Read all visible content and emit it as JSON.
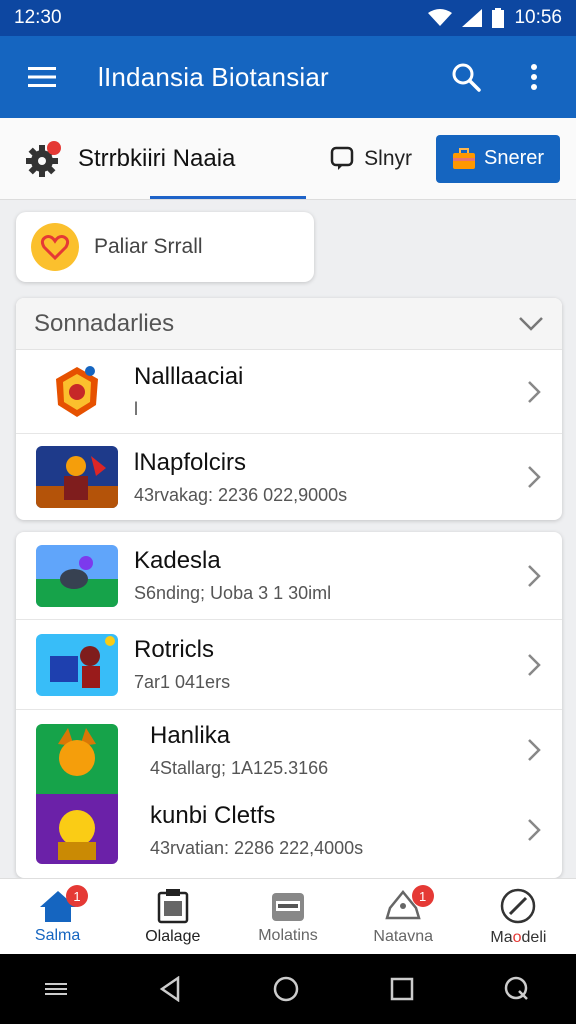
{
  "status_bar": {
    "time_left": "12:30",
    "time_right": "10:56"
  },
  "app_bar": {
    "title": "lIndansia Biotansiar"
  },
  "filter_row": {
    "title": "Strrbkiiri Naaia",
    "share_label": "Slnyr",
    "primary_label": "Snerer"
  },
  "chip": {
    "label": "Paliar Srrall"
  },
  "section1": {
    "header": "Sonnadarlies",
    "items": [
      {
        "title": "Nalllaaciai",
        "subtitle": "l"
      },
      {
        "title": "lNapfolcirs",
        "subtitle": "43rvakag: 2236 022,9000s"
      }
    ]
  },
  "section2": {
    "items": [
      {
        "title": "Kadesla",
        "subtitle": "S6nding; Uoba 3 1 30iml"
      },
      {
        "title": "Rotricls",
        "subtitle": "7ar1 041ers"
      },
      {
        "title": "Hanlika",
        "subtitle": "4Stallarg; 1A125.3166"
      },
      {
        "title": "kunbi Cletfs",
        "subtitle": "43rvatian: 2286 222,4000s"
      }
    ]
  },
  "bottom_nav": [
    {
      "label": "Salma",
      "badge": "1",
      "icon": "home-icon",
      "color": "#1565c0"
    },
    {
      "label": "Olalage",
      "badge": "",
      "icon": "clipboard-icon",
      "color": "#222222"
    },
    {
      "label": "Molatins",
      "badge": "",
      "icon": "archive-icon",
      "color": "#666666"
    },
    {
      "label": "Natavna",
      "badge": "1",
      "icon": "bell-icon",
      "color": "#666666"
    },
    {
      "label": "Maodeli",
      "label_accent": "o",
      "badge": "",
      "icon": "compass-icon",
      "color": "#333333"
    }
  ],
  "colors": {
    "primary": "#1565c0",
    "status_bar": "#0d47a1",
    "badge": "#e53935"
  }
}
